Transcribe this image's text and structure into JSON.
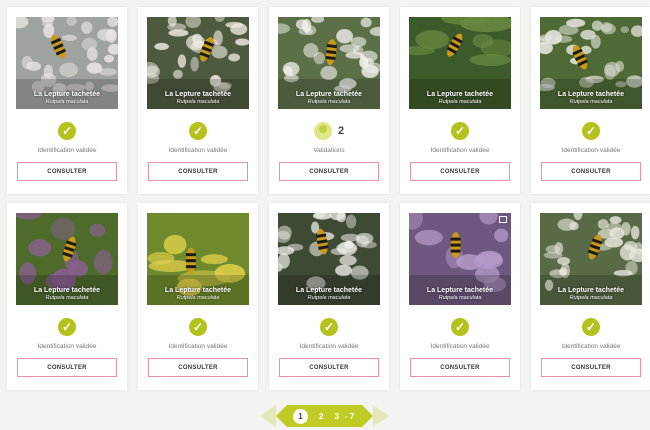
{
  "cards": [
    {
      "name": "La Lepture tachetée",
      "sci": "Rutpela maculata",
      "status": "Identification validée",
      "button": "CONSULTER",
      "icon": "check-icon",
      "bg": "#9fa3a0",
      "fg": "#e8e4e2",
      "pattern": "flower"
    },
    {
      "name": "La Lepture tachetée",
      "sci": "Rutpela maculata",
      "status": "Identification validée",
      "button": "CONSULTER",
      "icon": "check-icon",
      "bg": "#4e5a40",
      "fg": "#efeae0",
      "pattern": "flower"
    },
    {
      "name": "La Lepture tachetée",
      "sci": "Rutpela maculata",
      "status": "Validations",
      "count": "2",
      "button": "CONSULTER",
      "icon": "validation-icon",
      "bg": "#5c7048",
      "fg": "#f2f2ee",
      "pattern": "flower"
    },
    {
      "name": "La Lepture tachetée",
      "sci": "Rutpela maculata",
      "status": "Identification validée",
      "button": "CONSULTER",
      "icon": "check-icon",
      "bg": "#3d5a2a",
      "fg": "#6a8a40",
      "pattern": "leaf"
    },
    {
      "name": "La Lepture tachetée",
      "sci": "Rutpela maculata",
      "status": "Identification validée",
      "button": "CONSULTER",
      "icon": "check-icon",
      "bg": "#4f6a36",
      "fg": "#e6e8e0",
      "pattern": "flower"
    },
    {
      "name": "La Lepture tachetée",
      "sci": "Rutpela maculata",
      "status": "Identification validée",
      "button": "CONSULTER",
      "icon": "check-icon",
      "bg": "#4e6b2c",
      "fg": "#8a5f92",
      "pattern": "thistle"
    },
    {
      "name": "La Lepture tachetée",
      "sci": "Rutpela maculata",
      "status": "Identification validée",
      "button": "CONSULTER",
      "icon": "check-icon",
      "bg": "#6f8a2c",
      "fg": "#e2d24a",
      "pattern": "leaf"
    },
    {
      "name": "La Lepture tachetée",
      "sci": "Rutpela maculata",
      "status": "Identification validée",
      "button": "CONSULTER",
      "icon": "check-icon",
      "bg": "#3f4a34",
      "fg": "#efefea",
      "pattern": "flower"
    },
    {
      "name": "La Lepture tachetée",
      "sci": "Rutpela maculata",
      "status": "Identification validée",
      "button": "CONSULTER",
      "icon": "check-icon",
      "bg": "#6e5880",
      "fg": "#b49ac8",
      "pattern": "thistle",
      "expand": true
    },
    {
      "name": "La Lepture tachetée",
      "sci": "Rutpela maculata",
      "status": "Identification validée",
      "button": "CONSULTER",
      "icon": "check-icon",
      "bg": "#586a46",
      "fg": "#e8e8dc",
      "pattern": "flower"
    }
  ],
  "pagination": {
    "current": "1",
    "pages": [
      "2",
      "3",
      "- 7"
    ]
  },
  "colors": {
    "accent": "#c0cb25",
    "check": "#b5c21d",
    "button_border": "#e98fa8"
  }
}
